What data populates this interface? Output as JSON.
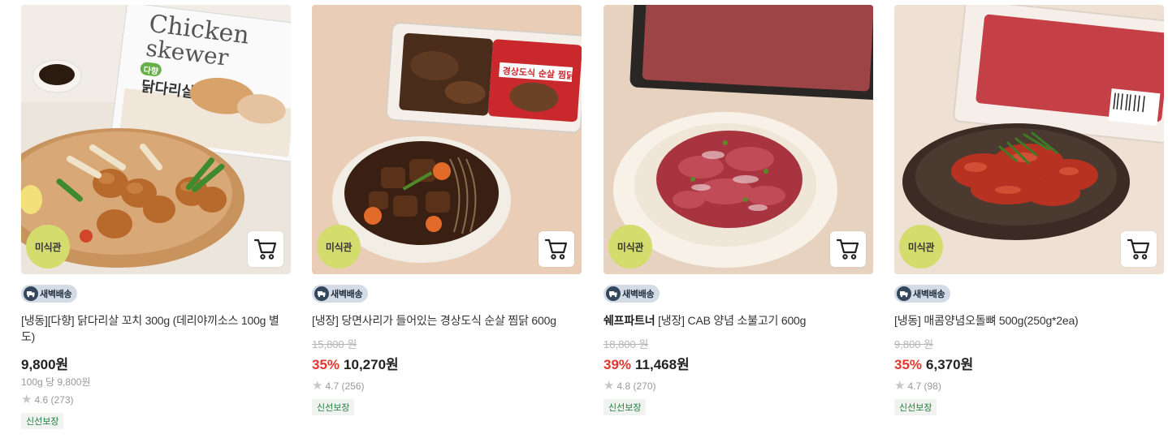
{
  "products": [
    {
      "image_badge": "미식관",
      "delivery_badge": "새벽배송",
      "brand": "",
      "title": "[냉동][다향] 닭다리살 꼬치 300g (데리야끼소스 100g 별도)",
      "package_text_en": "Chicken skewer",
      "package_text_ko": "닭다리살 꼬치",
      "package_brand": "다향",
      "original_price": "",
      "discount_rate": "",
      "price": "9,800원",
      "unit_price": "100g 당 9,800원",
      "rating": "4.6",
      "review_count": "(273)",
      "tag": "신선보장"
    },
    {
      "image_badge": "미식관",
      "delivery_badge": "새벽배송",
      "brand": "",
      "title": "[냉장] 당면사리가 들어있는 경상도식 순살 찜닭 600g",
      "package_text_ko": "경상도식 순살 찜닭",
      "original_price": "15,800 원",
      "discount_rate": "35%",
      "price": "10,270원",
      "unit_price": "",
      "rating": "4.7",
      "review_count": "(256)",
      "tag": "신선보장"
    },
    {
      "image_badge": "미식관",
      "delivery_badge": "새벽배송",
      "brand": "쉐프파트너",
      "title": "[냉장] CAB 양념 소불고기 600g",
      "original_price": "18,800 원",
      "discount_rate": "39%",
      "price": "11,468원",
      "unit_price": "",
      "rating": "4.8",
      "review_count": "(270)",
      "tag": "신선보장"
    },
    {
      "image_badge": "미식관",
      "delivery_badge": "새벽배송",
      "brand": "",
      "title": "[냉동] 매콤양념오돌뼈 500g(250g*2ea)",
      "original_price": "9,800 원",
      "discount_rate": "35%",
      "price": "6,370원",
      "unit_price": "",
      "rating": "4.7",
      "review_count": "(98)",
      "tag": "신선보장"
    }
  ],
  "icons": {
    "cart": "cart-icon",
    "truck": "truck-icon",
    "star": "star-icon"
  },
  "colors": {
    "discount": "#e4362c",
    "badge_misik": "#d3dc6d",
    "delivery_badge_bg": "#d3dbe6",
    "fresh_tag_text": "#1e7d3b"
  }
}
